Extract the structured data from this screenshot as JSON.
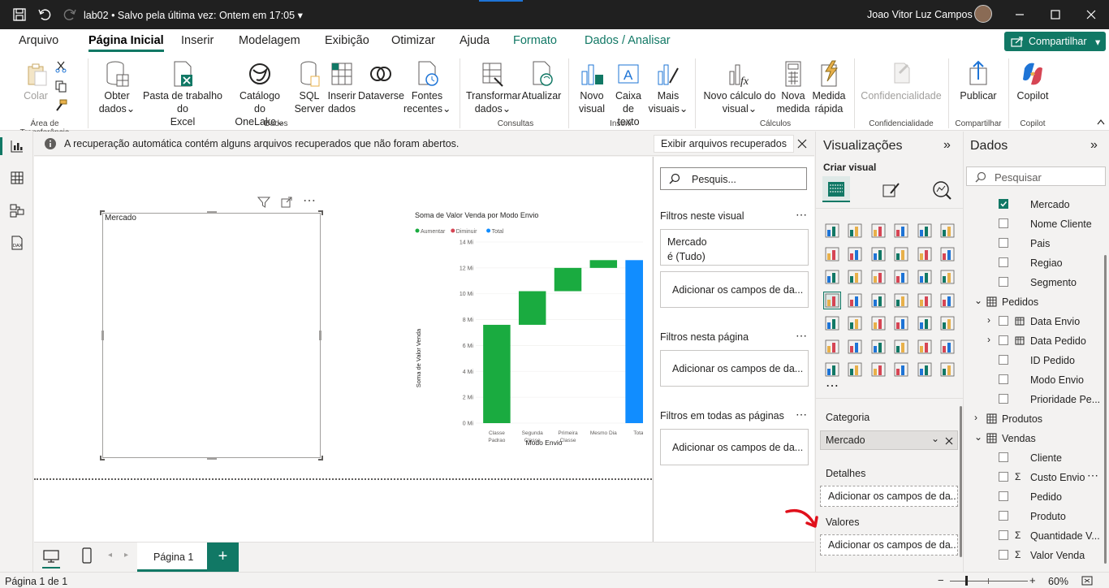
{
  "titlebar": {
    "file": "lab02",
    "save_status": "Salvo pela última vez: Ontem em 17:05",
    "user": "Joao Vitor Luz Campos"
  },
  "menu": {
    "tabs": [
      "Arquivo",
      "Página Inicial",
      "Inserir",
      "Modelagem",
      "Exibição",
      "Otimizar",
      "Ajuda",
      "Formato",
      "Dados / Analisar"
    ],
    "share": "Compartilhar"
  },
  "ribbon": {
    "colar": "Colar",
    "g_clip": "Área de Transferência",
    "obter_dados": [
      "Obter",
      "dados"
    ],
    "pasta_excel": [
      "Pasta de trabalho do",
      "Excel"
    ],
    "catalogo": [
      "Catálogo",
      "do OneLake"
    ],
    "sql": [
      "SQL",
      "Server"
    ],
    "inserir_dados": [
      "Inserir",
      "dados"
    ],
    "dataverse": "Dataverse",
    "fontes": [
      "Fontes",
      "recentes"
    ],
    "g_dados": "Dados",
    "transformar": [
      "Transformar",
      "dados"
    ],
    "atualizar": "Atualizar",
    "g_consultas": "Consultas",
    "novo_visual": [
      "Novo",
      "visual"
    ],
    "caixa_texto": [
      "Caixa de",
      "texto"
    ],
    "mais_visuais": [
      "Mais",
      "visuais"
    ],
    "g_inserir": "Inserir",
    "novo_calc": [
      "Novo cálculo do",
      "visual"
    ],
    "nova_medida": [
      "Nova",
      "medida"
    ],
    "medida_rapida": [
      "Medida",
      "rápida"
    ],
    "g_calculos": "Cálculos",
    "confidencialidade": "Confidencialidade",
    "g_conf": "Confidencialidade",
    "publicar": "Publicar",
    "g_comp": "Compartilhar",
    "copilot": "Copilot",
    "g_copilot": "Copilot"
  },
  "infobar": {
    "message": "A recuperação automática contém alguns arquivos recuperados que não foram abertos.",
    "button": "Exibir arquivos recuperados"
  },
  "slicer": {
    "title": "Mercado"
  },
  "chart_data": {
    "type": "waterfall",
    "title": "Soma de Valor Venda por Modo Envio",
    "legend": [
      "Aumentar",
      "Diminuir",
      "Total"
    ],
    "legend_colors": [
      "#1aab40",
      "#d64554",
      "#118dff"
    ],
    "xlabel": "Modo Envio",
    "ylabel": "Soma de Valor Venda",
    "ylim": [
      0,
      14
    ],
    "yticks": [
      "0 Mi",
      "2 Mi",
      "4 Mi",
      "6 Mi",
      "8 Mi",
      "10 Mi",
      "12 Mi",
      "14 Mi"
    ],
    "categories": [
      "Classe Padrao",
      "Segunda Classe",
      "Primeira Classe",
      "Mesmo Dia",
      "Total"
    ],
    "category_lines": [
      [
        "Classe",
        "Padrao"
      ],
      [
        "Segunda",
        "Classe"
      ],
      [
        "Primeira",
        "Classe"
      ],
      [
        "Mesmo Dia"
      ],
      [
        "Total"
      ]
    ],
    "values": [
      7.6,
      2.6,
      1.8,
      0.6,
      12.6
    ],
    "kinds": [
      "increase",
      "increase",
      "increase",
      "increase",
      "total"
    ]
  },
  "filters": {
    "search": "Pesquis...",
    "visual_header": "Filtros neste visual",
    "mercado_card": [
      "Mercado",
      "é (Tudo)"
    ],
    "add_fields": "Adicionar os campos de da...",
    "page_header": "Filtros nesta página",
    "all_header": "Filtros em todas as páginas"
  },
  "viz": {
    "title": "Visualizações",
    "build": "Criar visual",
    "categoria": "Categoria",
    "categoria_value": "Mercado",
    "detalhes": "Detalhes",
    "valores": "Valores",
    "add_fields": "Adicionar os campos de da..."
  },
  "data_pane": {
    "title": "Dados",
    "search": "Pesquisar",
    "items": [
      {
        "label": "Mercado",
        "checked": true,
        "indent": 2,
        "sigma": false
      },
      {
        "label": "Nome Cliente",
        "checked": false,
        "indent": 2,
        "sigma": false
      },
      {
        "label": "Pais",
        "checked": false,
        "indent": 2,
        "sigma": false
      },
      {
        "label": "Regiao",
        "checked": false,
        "indent": 2,
        "sigma": false
      },
      {
        "label": "Segmento",
        "checked": false,
        "indent": 2,
        "sigma": false
      },
      {
        "label": "Pedidos",
        "table": true,
        "open": true
      },
      {
        "label": "Data Envio",
        "checked": false,
        "indent": 2,
        "sigma": false,
        "expand": true,
        "date": true
      },
      {
        "label": "Data Pedido",
        "checked": false,
        "indent": 2,
        "sigma": false,
        "expand": true,
        "date": true
      },
      {
        "label": "ID Pedido",
        "checked": false,
        "indent": 2,
        "sigma": false
      },
      {
        "label": "Modo Envio",
        "checked": false,
        "indent": 2,
        "sigma": false
      },
      {
        "label": "Prioridade Pe...",
        "checked": false,
        "indent": 2,
        "sigma": false
      },
      {
        "label": "Produtos",
        "table": true,
        "open": false
      },
      {
        "label": "Vendas",
        "table": true,
        "open": true
      },
      {
        "label": "Cliente",
        "checked": false,
        "indent": 2,
        "sigma": false
      },
      {
        "label": "Custo Envio",
        "checked": false,
        "indent": 2,
        "sigma": true,
        "more": true
      },
      {
        "label": "Pedido",
        "checked": false,
        "indent": 2,
        "sigma": false
      },
      {
        "label": "Produto",
        "checked": false,
        "indent": 2,
        "sigma": false
      },
      {
        "label": "Quantidade V...",
        "checked": false,
        "indent": 2,
        "sigma": true
      },
      {
        "label": "Valor Venda",
        "checked": false,
        "indent": 2,
        "sigma": true
      }
    ]
  },
  "pages": {
    "tab": "Página 1",
    "status": "Página 1 de 1",
    "zoom": "60%"
  }
}
